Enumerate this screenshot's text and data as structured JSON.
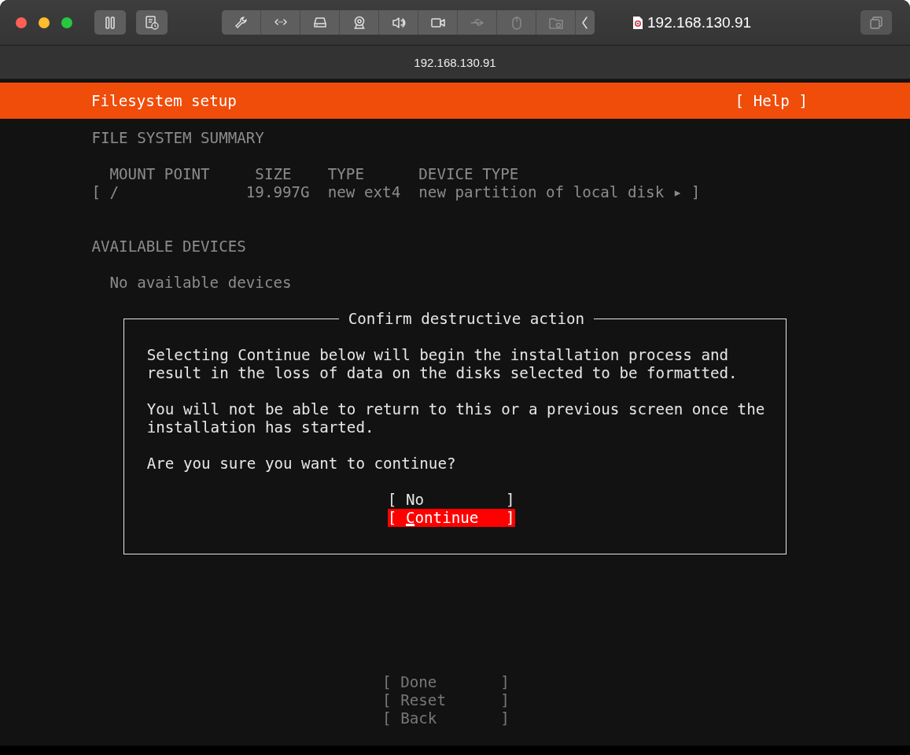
{
  "window": {
    "toolbar_title": "192.168.130.91",
    "title": "192.168.130.91",
    "tools": [
      {
        "kind": "wrench",
        "disabled": false
      },
      {
        "kind": "network",
        "disabled": false
      },
      {
        "kind": "drive",
        "disabled": false
      },
      {
        "kind": "webcam",
        "disabled": false
      },
      {
        "kind": "speaker",
        "disabled": false
      },
      {
        "kind": "camera",
        "disabled": false
      },
      {
        "kind": "usb",
        "disabled": true
      },
      {
        "kind": "mouse",
        "disabled": true
      },
      {
        "kind": "folder",
        "disabled": true
      },
      {
        "kind": "chevron",
        "disabled": false
      }
    ]
  },
  "header": {
    "title": "Filesystem setup",
    "help": "[ Help ]"
  },
  "summary": {
    "title": "FILE SYSTEM SUMMARY",
    "columns": [
      "MOUNT POINT",
      "SIZE",
      "TYPE",
      "DEVICE TYPE"
    ],
    "rows": [
      {
        "cells": [
          "[ /",
          "19.997G",
          "new ext4",
          "new partition of local disk ▸ ]"
        ]
      }
    ]
  },
  "available": {
    "title": "AVAILABLE DEVICES",
    "empty": "No available devices"
  },
  "dialog": {
    "title": "Confirm destructive action",
    "paragraphs": [
      "Selecting Continue below will begin the installation process and\nresult in the loss of data on the disks selected to be formatted.",
      "You will not be able to return to this or a previous screen once the\ninstallation has started.",
      "Are you sure you want to continue?"
    ],
    "buttons": [
      {
        "label": "[ No         ]",
        "selected": false
      },
      {
        "label": "[ Continue   ]",
        "selected": true
      }
    ]
  },
  "actions": [
    {
      "label": "[ Done       ]"
    },
    {
      "label": "[ Reset      ]"
    },
    {
      "label": "[ Back       ]"
    }
  ]
}
